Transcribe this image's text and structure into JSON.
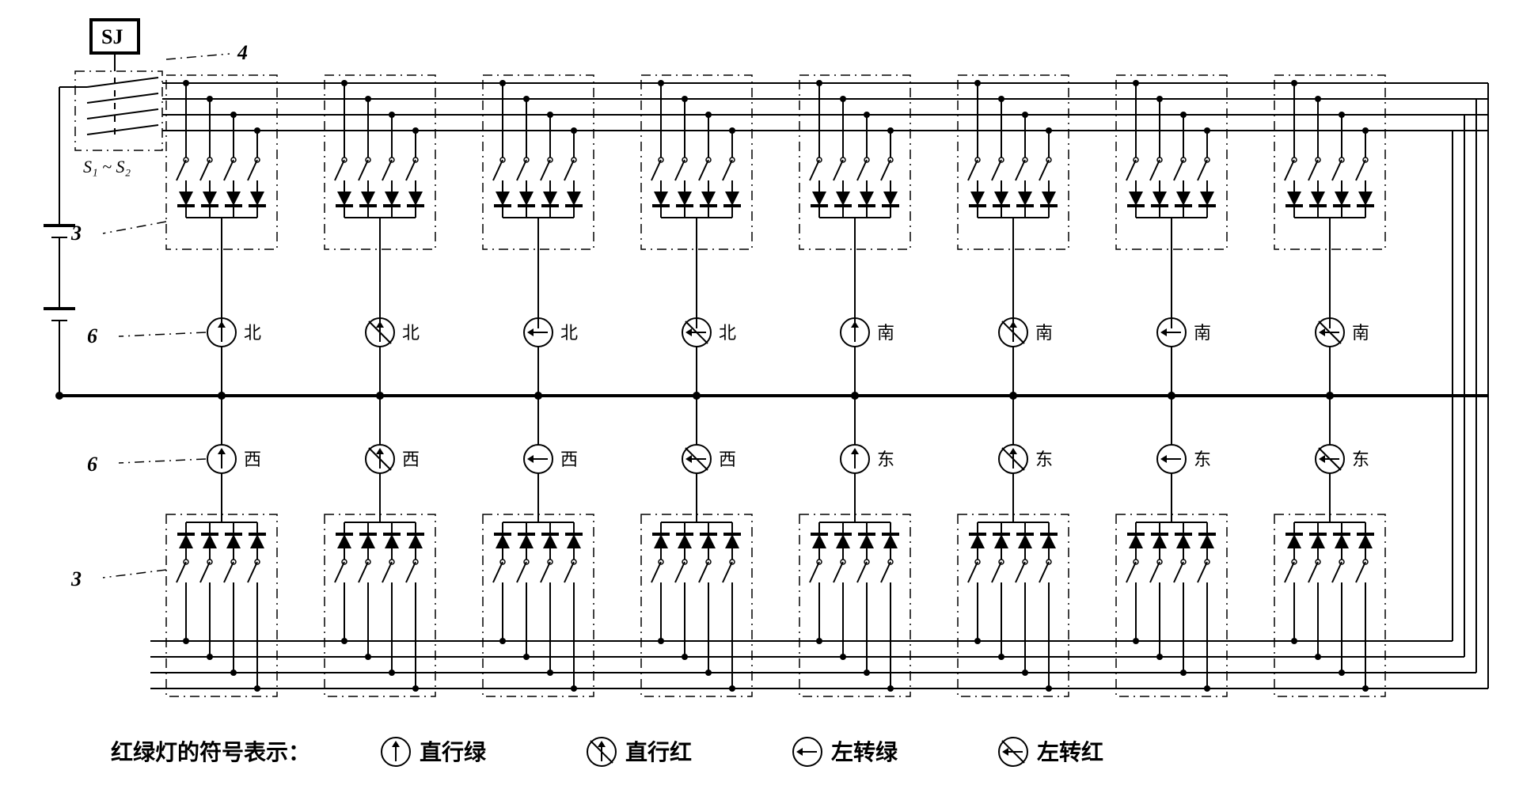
{
  "reference_labels": {
    "sj": "SJ",
    "switches": "S₁ ~ S₂",
    "r4": "4",
    "r3a": "3",
    "r3b": "3",
    "r6a": "6",
    "r6b": "6"
  },
  "directions_top": [
    "北",
    "北",
    "北",
    "北",
    "南",
    "南",
    "南",
    "南"
  ],
  "directions_bottom": [
    "西",
    "西",
    "西",
    "西",
    "东",
    "东",
    "东",
    "东"
  ],
  "legend": {
    "title": "红绿灯的符号表示：",
    "items": [
      {
        "symbol": "up",
        "text": "直行绿"
      },
      {
        "symbol": "up-slash",
        "text": "直行红"
      },
      {
        "symbol": "left",
        "text": "左转绿"
      },
      {
        "symbol": "left-slash",
        "text": "左转红"
      }
    ]
  },
  "chart_data": {
    "type": "table",
    "description": "Traffic-light control circuit schematic. SJ timer drives switch bank S1~S2 (ref 4). Two mirrored rows of 8 modules (ref 3) each containing 4 switches + 4 diodes feed 8 signal lamps (ref 6) per row. Top row lamps left→right: 北(straight-green, straight-red, left-green, left-red), 南(straight-green, straight-red, left-green, left-red). Bottom row lamps left→right: 西(same 4 types), 东(same 4 types).",
    "modules_per_row": 8,
    "switches_per_module": 4,
    "diodes_per_module": 4,
    "rows": [
      {
        "side": "top",
        "direction_groups": [
          {
            "dir": "北",
            "lamps": [
              "直行绿",
              "直行红",
              "左转绿",
              "左转红"
            ]
          },
          {
            "dir": "南",
            "lamps": [
              "直行绿",
              "直行红",
              "左转绿",
              "左转红"
            ]
          }
        ]
      },
      {
        "side": "bottom",
        "direction_groups": [
          {
            "dir": "西",
            "lamps": [
              "直行绿",
              "直行红",
              "左转绿",
              "左转红"
            ]
          },
          {
            "dir": "东",
            "lamps": [
              "直行绿",
              "直行红",
              "左转绿",
              "左转红"
            ]
          }
        ]
      }
    ]
  }
}
